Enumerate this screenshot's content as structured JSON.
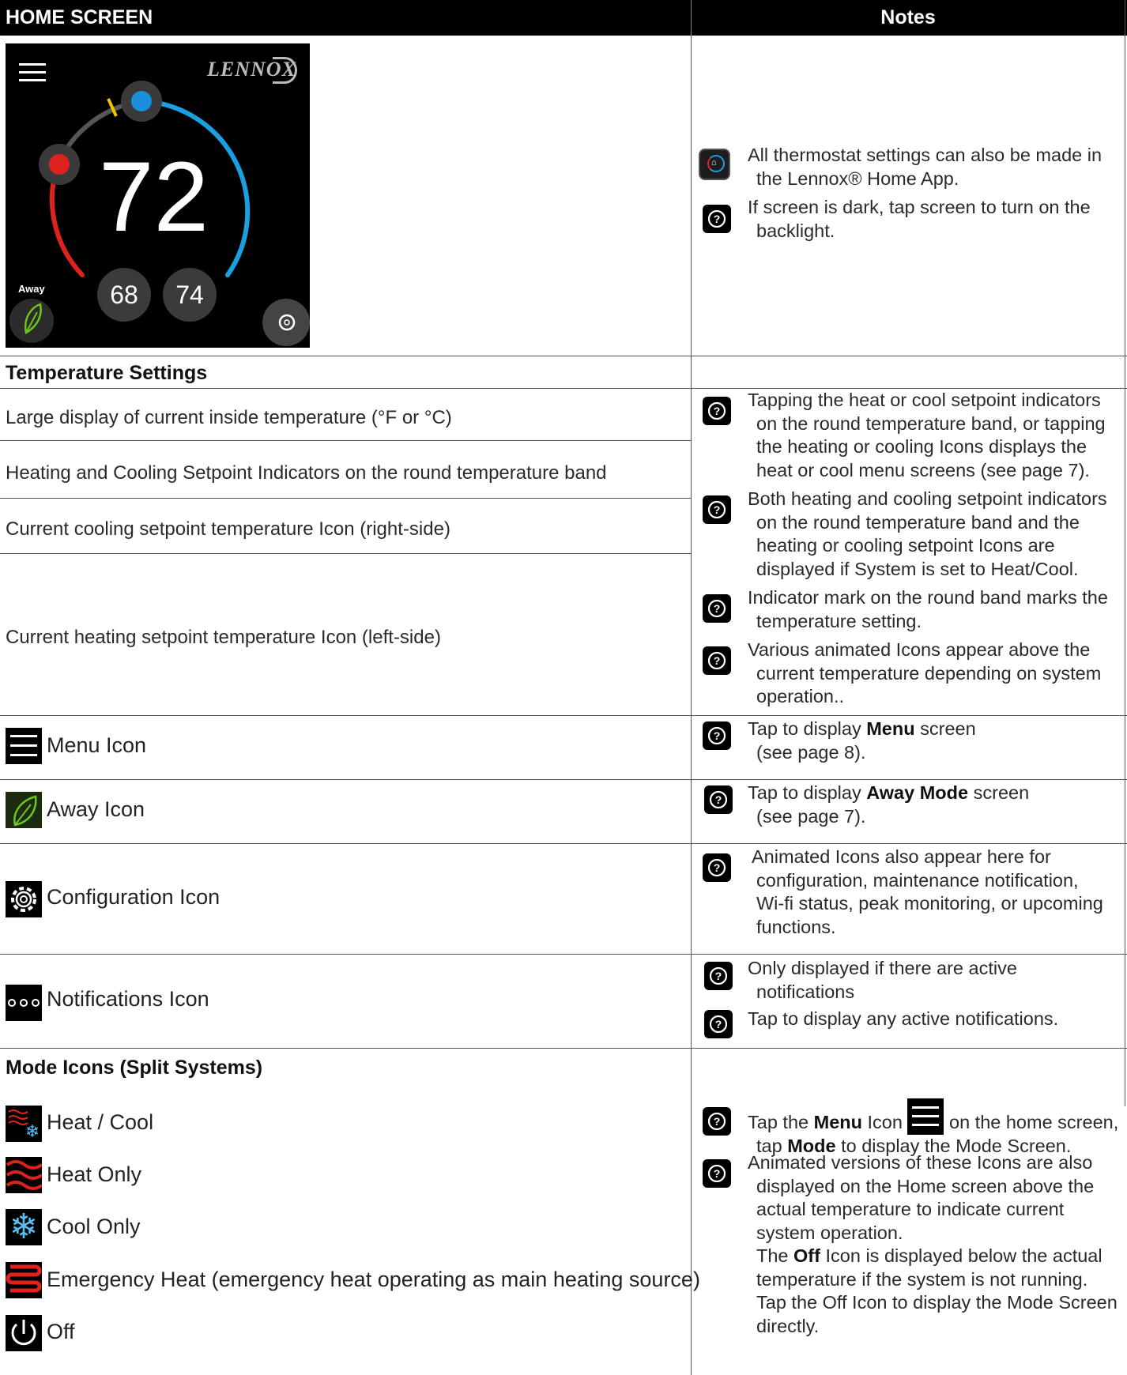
{
  "header": {
    "left": "HOME SCREEN",
    "right": "Notes"
  },
  "thermostat": {
    "brand": "LENNOX",
    "current_temp": "72",
    "heat_setpoint": "68",
    "cool_setpoint": "74",
    "away_label": "Away"
  },
  "top_notes": [
    "All thermostat settings can also be made in",
    "the Lennox® Home App.",
    "If screen is dark, tap screen to turn on the",
    "backlight."
  ],
  "temp_section": {
    "title": "Temperature Settings",
    "rows": [
      "Large display of current inside temperature (°F or °C)",
      "Heating and Cooling Setpoint Indicators on the round temperature band",
      "Current cooling setpoint temperature Icon (right-side)",
      "Current heating setpoint temperature Icon (left-side)"
    ],
    "notes": [
      [
        "Tapping the heat or cool setpoint indicators",
        "on the round temperature band, or tapping",
        "the heating or cooling  Icons displays the",
        "heat or cool menu screens (see page 7)."
      ],
      [
        "Both heating and cooling setpoint indicators",
        "on the round temperature band and the",
        "heating or cooling setpoint Icons are",
        "displayed if System is set to Heat/Cool."
      ],
      [
        "Indicator mark on the round band marks the",
        "temperature setting."
      ],
      [
        "Various animated Icons appear above the",
        "current temperature depending on system",
        "operation.."
      ]
    ]
  },
  "menu_row": {
    "label": "Menu Icon",
    "note_pre": "Tap to display ",
    "note_bold": "Menu",
    "note_post": " screen",
    "note_line2": "(see page 8)."
  },
  "away_row": {
    "label": "Away Icon",
    "note_pre": "Tap to display ",
    "note_bold": "Away Mode",
    "note_post": " screen",
    "note_line2": "(see page 7)."
  },
  "config_row": {
    "label": "Configuration Icon",
    "note": [
      "Animated Icons also appear here for",
      "configuration, maintenance notification,",
      "Wi-fi status, peak monitoring, or upcoming",
      "functions."
    ]
  },
  "notif_row": {
    "label": "Notifications Icon",
    "notes": [
      [
        "Only displayed if there are active",
        "notifications"
      ],
      [
        "Tap to display any active notifications."
      ]
    ]
  },
  "mode_section": {
    "title": "Mode Icons (Split Systems)",
    "items": [
      "Heat / Cool",
      "Heat Only",
      "Cool Only",
      "Emergency Heat (emergency heat operating as main heating source)",
      "Off"
    ],
    "note1_a": "Tap the ",
    "note1_b": "Menu",
    "note1_c": " Icon ",
    "note1_d": " on the home screen,",
    "note1_line2_a": "tap ",
    "note1_line2_b": "Mode",
    "note1_line2_c": " to display the Mode Screen.",
    "note2": [
      "Animated versions of these Icons are also",
      "displayed on the Home screen above the",
      "actual temperature to indicate current",
      "system operation."
    ],
    "note3_a": "The ",
    "note3_b": "Off",
    "note3_c": " Icon is displayed below the actual",
    "note3_rest": [
      "temperature if the system is not running.",
      "Tap the Off Icon to display the Mode Screen",
      "directly."
    ]
  },
  "colors": {
    "heat": "#e0221e",
    "cool": "#1aa0e0",
    "leaf": "#6cc51b",
    "away_bg": "#1f6b1f"
  }
}
